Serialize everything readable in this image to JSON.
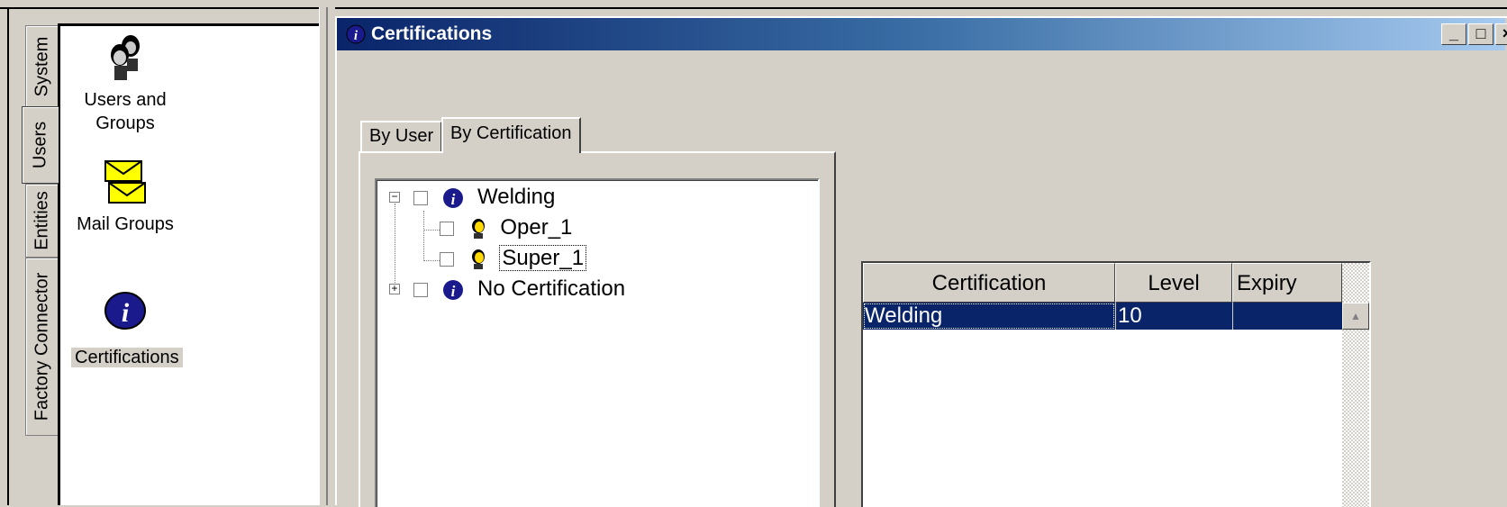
{
  "side_tabs": [
    {
      "label": "System",
      "active": false
    },
    {
      "label": "Users",
      "active": true
    },
    {
      "label": "Entities",
      "active": false
    },
    {
      "label": "Factory Connector",
      "active": false
    }
  ],
  "icon_panel": {
    "items": [
      {
        "label_line1": "Users and",
        "label_line2": "Groups",
        "icon": "users-and-groups-icon"
      },
      {
        "label_line1": "Mail Groups",
        "icon": "mail-groups-icon"
      },
      {
        "label_line1": "Certifications",
        "icon": "certifications-info-icon",
        "selected": true
      }
    ]
  },
  "window": {
    "title": "Certifications",
    "buttons": {
      "minimize": "_",
      "maximize": "□",
      "close": "×"
    }
  },
  "tabs": [
    {
      "label": "By User",
      "active": false
    },
    {
      "label": "By Certification",
      "active": true
    }
  ],
  "tree": {
    "nodes": [
      {
        "label": "Welding",
        "expander": "−",
        "icon": "info-icon",
        "children": [
          {
            "label": "Oper_1",
            "icon": "user-icon"
          },
          {
            "label": "Super_1",
            "icon": "user-icon",
            "focused": true
          }
        ]
      },
      {
        "label": "No Certification",
        "expander": "+",
        "icon": "info-icon"
      }
    ]
  },
  "list": {
    "columns": [
      "Certification",
      "Level",
      "Expiry"
    ],
    "rows": [
      {
        "certification": "Welding",
        "level": "10",
        "expiry": "",
        "selected": true
      }
    ]
  },
  "colors": {
    "face": "#d4d0c8",
    "selection": "#0a246a",
    "title_start": "#0a246a",
    "title_end": "#a6caf0"
  }
}
